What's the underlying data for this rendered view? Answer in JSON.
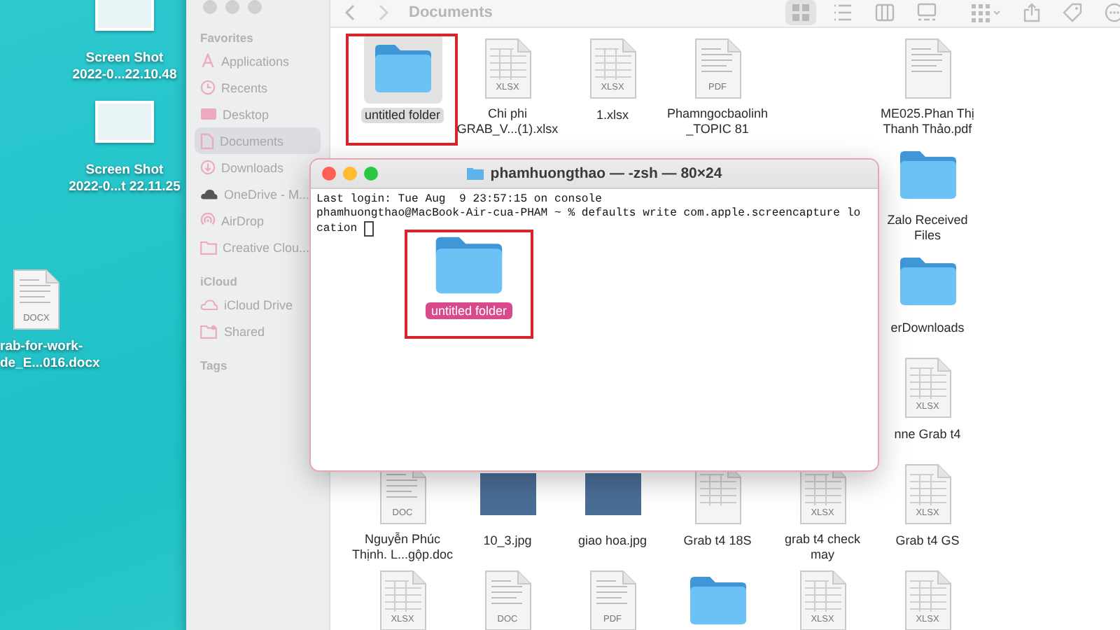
{
  "desktop": {
    "icons": [
      {
        "kind": "screenshot",
        "lines": [
          "Screen Shot",
          "2022-0...22.10.48"
        ]
      },
      {
        "kind": "screenshot",
        "lines": [
          "Screen Shot",
          "2022-0...t 22.11.25"
        ]
      },
      {
        "kind": "document",
        "icon_label": "DOCX",
        "lines": [
          "rab-for-work-",
          "de_E...016.docx"
        ]
      }
    ]
  },
  "finder": {
    "title": "Documents",
    "views": [
      {
        "kind": "icons",
        "selected": true
      },
      {
        "kind": "list",
        "selected": false
      },
      {
        "kind": "columns",
        "selected": false
      },
      {
        "kind": "gallery",
        "selected": false
      }
    ],
    "sidebar": {
      "sections": [
        {
          "title": "Favorites",
          "items": [
            {
              "label": "Applications",
              "kind": "applications",
              "selected": false
            },
            {
              "label": "Recents",
              "kind": "recents",
              "selected": false
            },
            {
              "label": "Desktop",
              "kind": "desktop",
              "selected": false
            },
            {
              "label": "Documents",
              "kind": "documents",
              "selected": true
            },
            {
              "label": "Downloads",
              "kind": "downloads",
              "selected": false
            },
            {
              "label": "OneDrive - M...",
              "kind": "onedrive",
              "selected": false
            },
            {
              "label": "AirDrop",
              "kind": "airdrop",
              "selected": false
            },
            {
              "label": "Creative Clou...",
              "kind": "folder",
              "selected": false
            }
          ]
        },
        {
          "title": "iCloud",
          "items": [
            {
              "label": "iCloud Drive",
              "kind": "icloud",
              "selected": false
            },
            {
              "label": "Shared",
              "kind": "shared",
              "selected": false
            }
          ]
        },
        {
          "title": "Tags"
        }
      ]
    },
    "rows": [
      {
        "items": [
          {
            "kind": "folder",
            "lines": [
              "untitled folder"
            ],
            "selected": true
          },
          {
            "kind": "spreadsheet",
            "icon_label": "XLSX",
            "lines": [
              "Chi phi",
              "GRAB_V...(1).xlsx"
            ],
            "selected": false
          },
          {
            "kind": "spreadsheet",
            "icon_label": "XLSX",
            "lines": [
              "1.xlsx"
            ],
            "selected": false
          },
          {
            "kind": "document",
            "icon_label": "PDF",
            "lines": [
              "Phamngocbaolinh",
              "_TOPIC 81"
            ],
            "selected": false
          },
          {
            "kind": "document",
            "lines": [
              "ME025.Phan Thị",
              "Thanh Thảo.pdf"
            ],
            "selected": false
          }
        ]
      },
      {
        "items": [
          {
            "kind": "folder",
            "lines": [
              "Zalo Received",
              "Files"
            ],
            "selected": false
          }
        ]
      },
      {
        "items": [
          {
            "kind": "folder",
            "lines": [
              "erDownloads"
            ],
            "selected": false
          }
        ]
      },
      {
        "items": [
          {
            "kind": "spreadsheet",
            "icon_label": "XLSX",
            "lines": [
              "nne Grab t4"
            ],
            "selected": false
          }
        ]
      },
      {
        "items": [
          {
            "kind": "document",
            "icon_label": "DOC",
            "lines": [
              "Nguyễn Phúc",
              "Thịnh. L...gộp.doc"
            ],
            "selected": false
          },
          {
            "kind": "image",
            "lines": [
              "10_3.jpg"
            ],
            "selected": false
          },
          {
            "kind": "image",
            "lines": [
              "giao hoa.jpg"
            ],
            "selected": false
          },
          {
            "kind": "spreadsheet",
            "lines": [
              "Grab t4 18S"
            ],
            "selected": false
          },
          {
            "kind": "spreadsheet",
            "icon_label": "XLSX",
            "lines": [
              "grab t4 check",
              "may"
            ],
            "selected": false
          },
          {
            "kind": "spreadsheet",
            "icon_label": "XLSX",
            "lines": [
              "Grab t4 GS"
            ],
            "selected": false
          }
        ]
      },
      {
        "items": [
          {
            "kind": "spreadsheet",
            "icon_label": "XLSX",
            "selected": false
          },
          {
            "kind": "document",
            "icon_label": "DOC",
            "selected": false
          },
          {
            "kind": "document",
            "icon_label": "PDF",
            "selected": false
          },
          {
            "kind": "folder",
            "selected": false
          },
          {
            "kind": "spreadsheet",
            "icon_label": "XLSX",
            "selected": false
          },
          {
            "kind": "spreadsheet",
            "icon_label": "XLSX",
            "selected": false
          }
        ]
      }
    ]
  },
  "terminal": {
    "title": "phamhuongthao — -zsh — 80×24",
    "lines": [
      "Last login: Tue Aug  9 23:57:15 on console",
      "phamhuongthao@MacBook-Air-cua-PHAM ~ % defaults write com.apple.screencapture lo",
      "cation "
    ]
  },
  "dragged_folder": {
    "label": "untitled folder"
  }
}
